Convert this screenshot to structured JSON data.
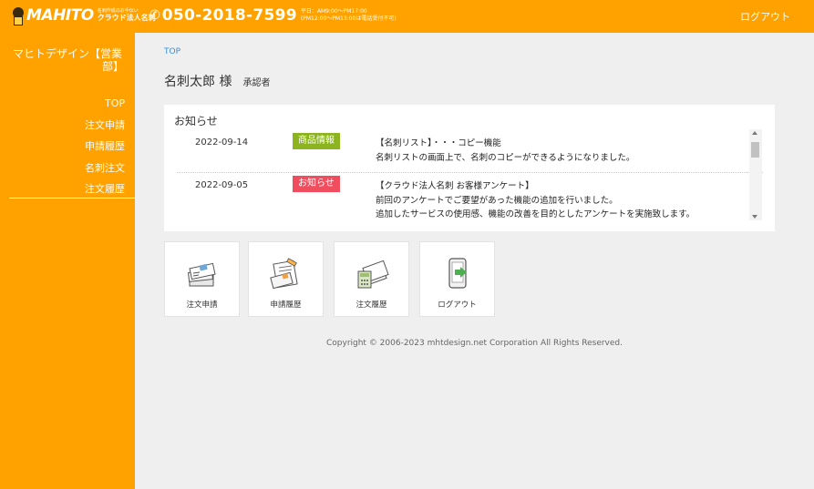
{
  "header": {
    "logo_text": "MAHITO",
    "logo_tagline": "名刺作成のお手伝い",
    "logo_product": "クラウド法人名刺",
    "phone_number": "050-2018-7599",
    "hours_line1": "平日：AM9:00～PM17:00",
    "hours_line2": "(PM12:00～PM13:00は電話受付不可)",
    "logout_label": "ログアウト"
  },
  "sidebar": {
    "company_line1": "マヒトデザイン【営業",
    "company_line2": "部】",
    "items": [
      {
        "label": "TOP"
      },
      {
        "label": "注文申請"
      },
      {
        "label": "申請履歴"
      },
      {
        "label": "名刺注文"
      },
      {
        "label": "注文履歴"
      }
    ]
  },
  "main": {
    "breadcrumb": "TOP",
    "user_name": "名刺太郎 様",
    "user_role": "承認者"
  },
  "news": {
    "title": "お知らせ",
    "items": [
      {
        "date": "2022-09-14",
        "badge": "商品情報",
        "badge_color": "#8cb320",
        "line1": "【名刺リスト】・・・コピー機能",
        "line2": "名刺リストの画面上で、名刺のコピーができるようになりました。",
        "line3": ""
      },
      {
        "date": "2022-09-05",
        "badge": "お知らせ",
        "badge_color": "#f04e5e",
        "line1": "【クラウド法人名刺 お客様アンケート】",
        "line2": "前回のアンケートでご要望があった機能の追加を行いました。",
        "line3": "追加したサービスの使用感、機能の改善を目的としたアンケートを実施致します。"
      }
    ]
  },
  "tiles": [
    {
      "label": "注文申請",
      "icon": "cards-stack-icon"
    },
    {
      "label": "申請履歴",
      "icon": "cards-document-icon"
    },
    {
      "label": "注文履歴",
      "icon": "cards-calculator-icon"
    },
    {
      "label": "ログアウト",
      "icon": "logout-door-icon"
    }
  ],
  "footer": {
    "copyright": "Copyright © 2006-2023 mhtdesign.net Corporation All Rights Reserved."
  },
  "colors": {
    "brand_orange": "#ffa200",
    "background": "#efefef",
    "link_blue": "#3a8fd6"
  }
}
